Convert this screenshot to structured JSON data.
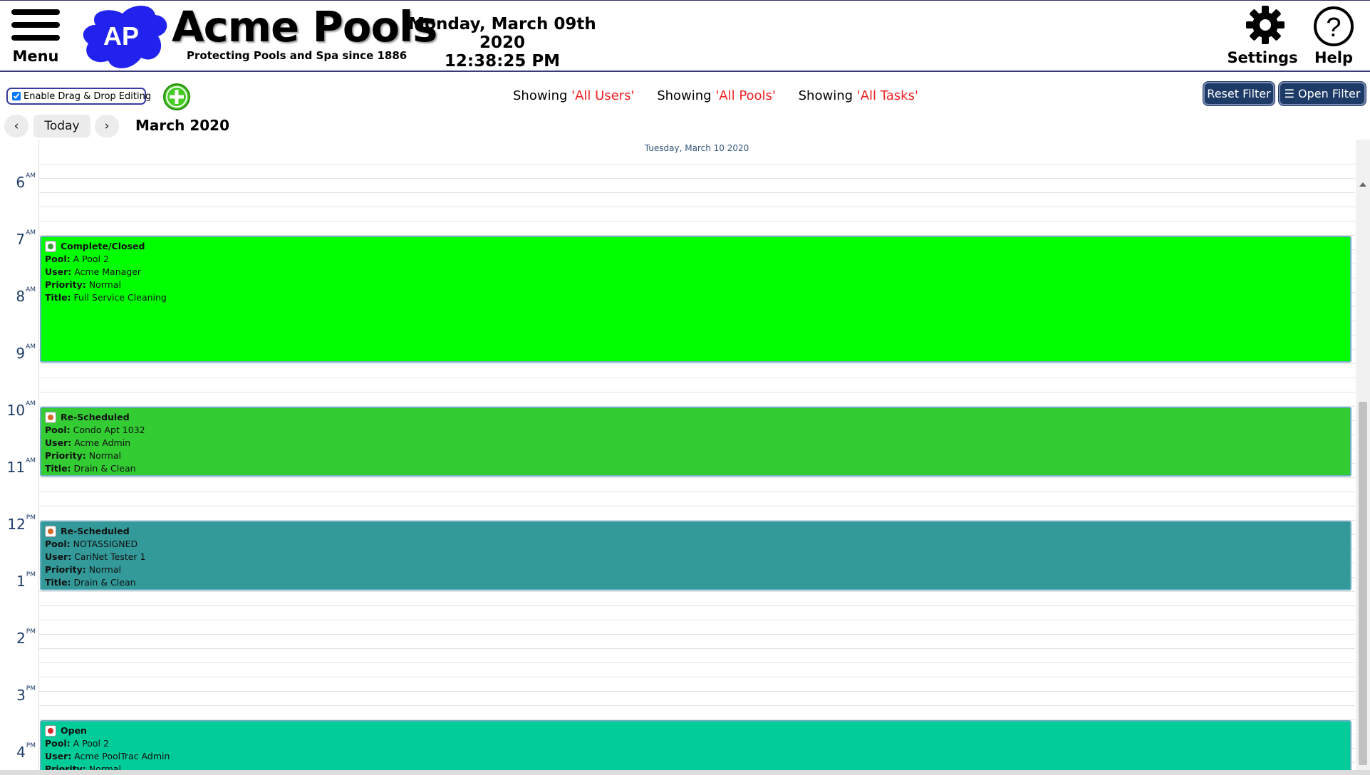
{
  "header": {
    "menu_label": "Menu",
    "logo_text": "AP",
    "brand_name": "Acme Pools",
    "brand_tagline": "Protecting Pools and Spa since 1886",
    "date": "Monday, March 09th 2020",
    "time": "12:38:25 PM",
    "settings_label": "Settings",
    "help_label": "Help"
  },
  "toolbar": {
    "drag_drop_label": "Enable Drag & Drop Editing",
    "drag_drop_checked": true,
    "filters": [
      {
        "prefix": "Showing ",
        "value": "'All Users'"
      },
      {
        "prefix": "Showing ",
        "value": "'All Pools'"
      },
      {
        "prefix": "Showing ",
        "value": "'All Tasks'"
      }
    ],
    "reset_filter_label": "Reset Filter",
    "open_filter_label": "☰ Open Filter",
    "prev_label": "‹",
    "today_label": "Today",
    "next_label": "›",
    "month_title": "March 2020"
  },
  "calendar": {
    "day_header": "Tuesday, March 10 2020",
    "hours": [
      {
        "num": "6",
        "ampm": "AM"
      },
      {
        "num": "7",
        "ampm": "AM"
      },
      {
        "num": "8",
        "ampm": "AM"
      },
      {
        "num": "9",
        "ampm": "AM"
      },
      {
        "num": "10",
        "ampm": "AM"
      },
      {
        "num": "11",
        "ampm": "AM"
      },
      {
        "num": "12",
        "ampm": "PM"
      },
      {
        "num": "1",
        "ampm": "PM"
      },
      {
        "num": "2",
        "ampm": "PM"
      },
      {
        "num": "3",
        "ampm": "PM"
      },
      {
        "num": "4",
        "ampm": "PM"
      }
    ],
    "field_labels": {
      "pool": "Pool:",
      "user": "User:",
      "priority": "Priority:",
      "title": "Title:"
    },
    "events": [
      {
        "status": "Complete/Closed",
        "status_icon": "check-icon",
        "pool": "A Pool 2",
        "user": "Acme Manager",
        "priority": "Normal",
        "title": "Full Service Cleaning",
        "color": "#00ff00",
        "start": "7:00 AM",
        "end": "9:15 AM"
      },
      {
        "status": "Re-Scheduled",
        "status_icon": "reschedule-icon",
        "pool": "Condo Apt 1032",
        "user": "Acme Admin",
        "priority": "Normal",
        "title": "Drain & Clean",
        "color": "#33cc33",
        "start": "10:00 AM",
        "end": "11:15 AM"
      },
      {
        "status": "Re-Scheduled",
        "status_icon": "reschedule-icon",
        "pool": "NOTASSIGNED",
        "user": "CariNet Tester 1",
        "priority": "Normal",
        "title": "Drain & Clean",
        "color": "#339999",
        "start": "12:00 PM",
        "end": "1:15 PM"
      },
      {
        "status": "Open",
        "status_icon": "open-icon",
        "pool": "A Pool 2",
        "user": "Acme PoolTrac Admin",
        "priority": "Normal",
        "title": "",
        "color": "#00cc99",
        "start": "3:30 PM",
        "end": ""
      }
    ]
  }
}
